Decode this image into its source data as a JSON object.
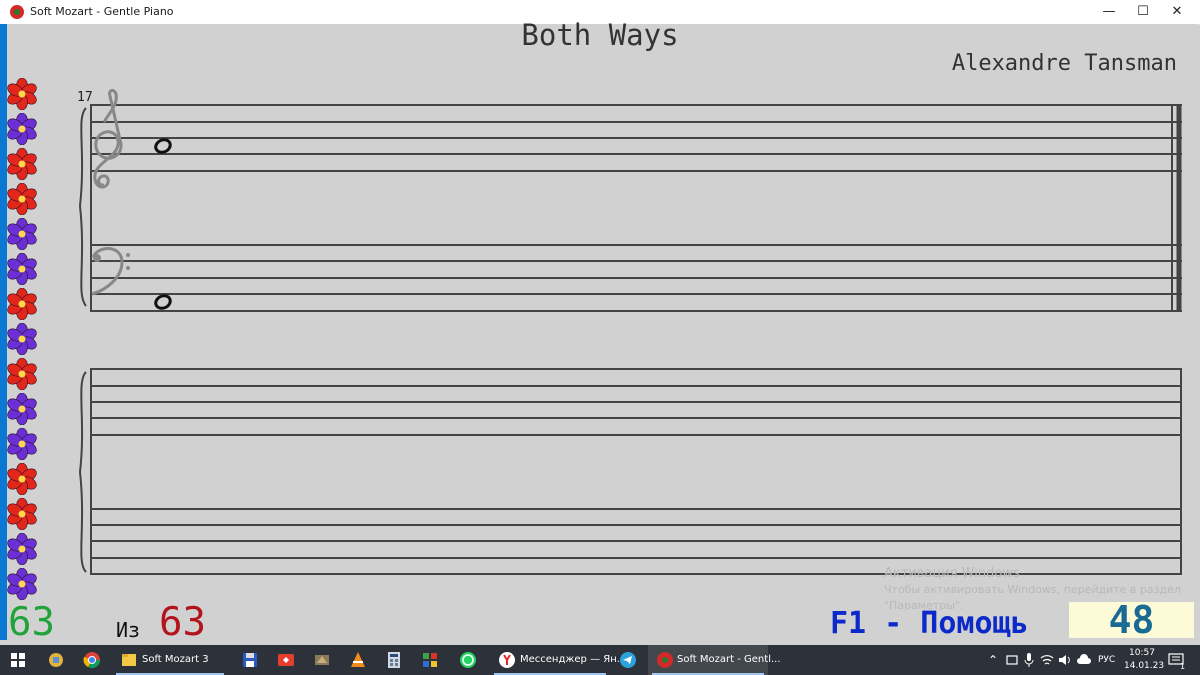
{
  "window": {
    "title": "Soft Mozart - Gentle Piano",
    "minimize": "—",
    "maximize": "☐",
    "close": "✕"
  },
  "score": {
    "title": "Both Ways",
    "composer": "Alexandre Tansman",
    "measure_number": "17"
  },
  "flowers": [
    "red",
    "purple",
    "red",
    "red",
    "purple",
    "purple",
    "red",
    "purple",
    "red",
    "purple",
    "purple",
    "red",
    "red",
    "purple",
    "purple"
  ],
  "colors": {
    "red_flower": "#e2261c",
    "purple_flower": "#6b2fd6",
    "flower_center": "#ffd84a"
  },
  "counters": {
    "current": "63",
    "of_label": "Из",
    "total": "63",
    "help": "F1 - Помощь",
    "score_value": "48"
  },
  "watermark": {
    "title": "Активация Windows",
    "line1": "Чтобы активировать Windows, перейдите в раздел",
    "line2": "\"Параметры\"."
  },
  "taskbar": {
    "items": [
      {
        "name": "start-icon"
      },
      {
        "name": "explorer-tools-icon"
      },
      {
        "name": "chrome-icon"
      },
      {
        "name": "folder-icon",
        "label": "Soft Mozart 3"
      },
      {
        "name": "floppy-icon"
      },
      {
        "name": "anydesk-icon"
      },
      {
        "name": "utility-icon"
      },
      {
        "name": "vlc-icon"
      },
      {
        "name": "calculator-icon"
      },
      {
        "name": "games-icon"
      },
      {
        "name": "whatsapp-icon"
      },
      {
        "name": "yandex-icon",
        "label": "Мессенджер — Ян..."
      },
      {
        "name": "telegram-icon"
      },
      {
        "name": "softmozart-icon",
        "label": "Soft Mozart - Gentl..."
      }
    ],
    "language": "РУС",
    "time": "10:57",
    "date": "14.01.23",
    "notifications": "1"
  }
}
